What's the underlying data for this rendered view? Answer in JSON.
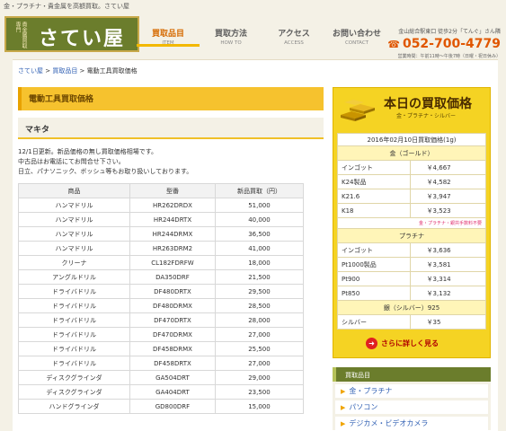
{
  "topbar": {
    "text": "金・プラチナ・貴金属を高額買取。さてい屋"
  },
  "logo": {
    "small": "貴金属買取専門",
    "big": "さてい屋"
  },
  "nav": [
    {
      "jp": "買取品目",
      "en": "ITEM"
    },
    {
      "jp": "買取方法",
      "en": "HOW TO"
    },
    {
      "jp": "アクセス",
      "en": "ACCESS"
    },
    {
      "jp": "お問い合わせ",
      "en": "CONTACT"
    }
  ],
  "contact": {
    "address": "金山総合駅東口 徒歩2分「てんぐ」さん隣",
    "phone": "052-700-4779",
    "hours": "営業時間：午前11時〜午後7時（日曜・祝日休み）"
  },
  "breadcrumb": {
    "home": "さてい屋",
    "sep1": " > ",
    "items": "買取品目",
    "sep2": " > ",
    "current": "電動工具買取価格"
  },
  "main": {
    "heading": "電動工具買取価格",
    "brand": "マキタ",
    "desc": [
      "12/1日更新。新品価格の無し買取価格相場です。",
      "中古品はお電話にてお問合せ下さい。",
      "日立、パナソニック、ボッシュ等もお取り扱いしております。"
    ],
    "table": {
      "headers": [
        "商品",
        "型番",
        "新品買取（円）"
      ],
      "rows": [
        [
          "ハンマドリル",
          "HR262DRDX",
          "51,000"
        ],
        [
          "ハンマドリル",
          "HR244DRTX",
          "40,000"
        ],
        [
          "ハンマドリル",
          "HR244DRMX",
          "36,500"
        ],
        [
          "ハンマドリル",
          "HR263DRM2",
          "41,000"
        ],
        [
          "クリーナ",
          "CL182FDRFW",
          "18,000"
        ],
        [
          "アングルドリル",
          "DA350DRF",
          "21,500"
        ],
        [
          "ドライバドリル",
          "DF480DRTX",
          "29,500"
        ],
        [
          "ドライバドリル",
          "DF480DRMX",
          "28,500"
        ],
        [
          "ドライバドリル",
          "DF470DRTX",
          "28,000"
        ],
        [
          "ドライバドリル",
          "DF470DRMX",
          "27,000"
        ],
        [
          "ドライバドリル",
          "DF458DRMX",
          "25,500"
        ],
        [
          "ドライバドリル",
          "DF458DRTX",
          "27,000"
        ],
        [
          "ディスクグラインダ",
          "GA504DRT",
          "29,000"
        ],
        [
          "ディスクグラインダ",
          "GA404DRT",
          "23,500"
        ],
        [
          "ハンドグラインダ",
          "GD800DRF",
          "15,000"
        ]
      ]
    }
  },
  "today": {
    "title": "本日の買取価格",
    "subtitle": "金・プラチナ・シルバー",
    "date": "2016年02月10日買取価格(1g)",
    "gold_header": "金（ゴールド）",
    "gold": [
      [
        "インゴット",
        "￥4,667"
      ],
      [
        "K24製品",
        "￥4,582"
      ],
      [
        "K21.6",
        "￥3,947"
      ],
      [
        "K18",
        "￥3,523"
      ]
    ],
    "note": "金・プラチナ・銀共手数料不要",
    "plat_header": "プラチナ",
    "platinum": [
      [
        "インゴット",
        "￥3,636"
      ],
      [
        "Pt1000製品",
        "￥3,581"
      ],
      [
        "Pt900",
        "￥3,314"
      ],
      [
        "Pt850",
        "￥3,132"
      ]
    ],
    "silver_header": "銀（シルバー）925",
    "silver": [
      [
        "シルバー",
        "￥35"
      ]
    ],
    "more": "さらに詳しく見る"
  },
  "menu": {
    "header": "買取品目",
    "items": [
      "金・プラチナ",
      "パソコン",
      "デジカメ・ビデオカメラ"
    ]
  },
  "colors": {
    "accent": "#f6c22e",
    "brand_green": "#6b7d2c",
    "phone_orange": "#e05600"
  }
}
